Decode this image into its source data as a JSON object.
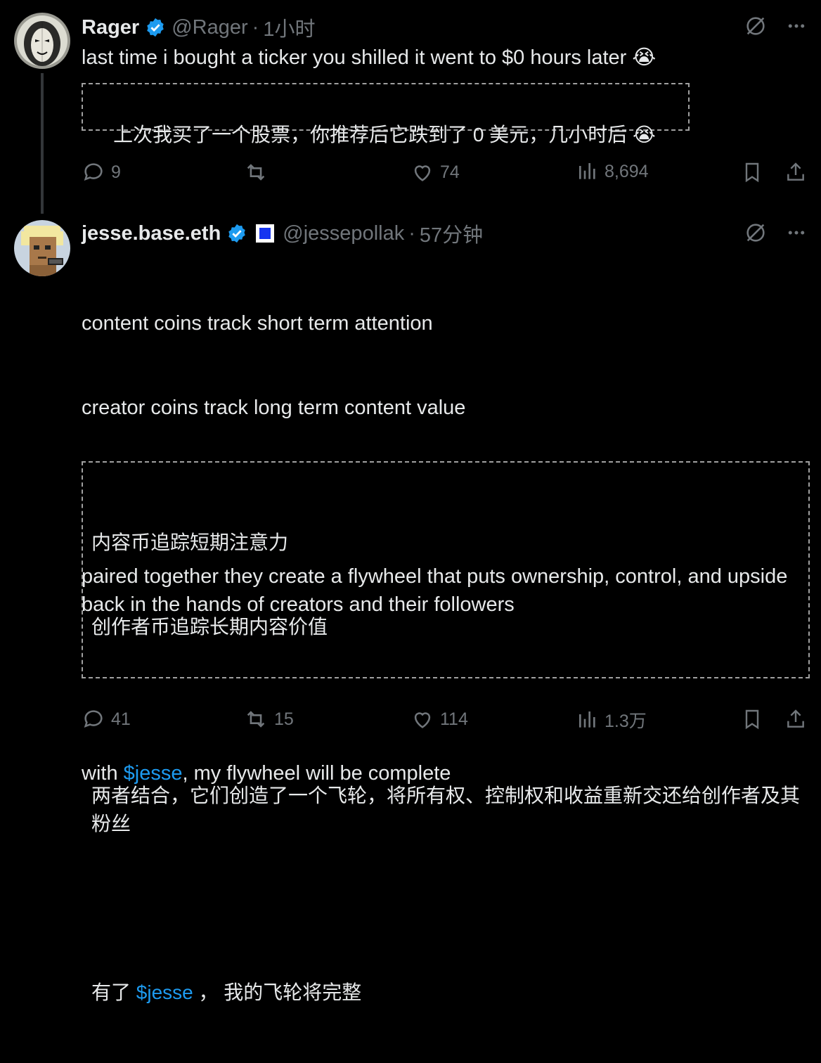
{
  "tweet1": {
    "name": "Rager",
    "handle": "@Rager",
    "dot": "·",
    "time": "1小时",
    "text": "last time i bought a ticker you shilled it went to $0 hours later 😭",
    "translation": "上次我买了一个股票，你推荐后它跌到了 0 美元，几小时后 😭",
    "replies": "9",
    "reposts": "",
    "likes": "74",
    "views": "8,694"
  },
  "tweet2": {
    "name": "jesse.base.eth",
    "handle": "@jessepollak",
    "dot": "·",
    "time": "57分钟",
    "text_line1": "content coins track short term attention",
    "text_line2": "creator coins track long term content value",
    "text_para2": "paired together they create a flywheel that puts ownership, control, and upside back in the hands of creators and their followers",
    "text_p3_pre": "with ",
    "cashtag": "$jesse",
    "text_p3_post": ", my flywheel will be complete",
    "tr_line1": "内容币追踪短期注意力",
    "tr_line2": "创作者币追踪长期内容价值",
    "tr_para2": "两者结合，它们创造了一个飞轮，将所有权、控制权和收益重新交还给创作者及其粉丝",
    "tr_p3_pre": "有了 ",
    "tr_cashtag": "$jesse",
    "tr_p3_post": " ， 我的飞轮将完整",
    "replies": "41",
    "reposts": "15",
    "likes": "114",
    "views": "1.3万"
  },
  "colors": {
    "background": "#000000",
    "text": "#e7e9ea",
    "muted": "#71767b",
    "accent": "#1d9bf0",
    "verified": "#1d9bf0"
  }
}
